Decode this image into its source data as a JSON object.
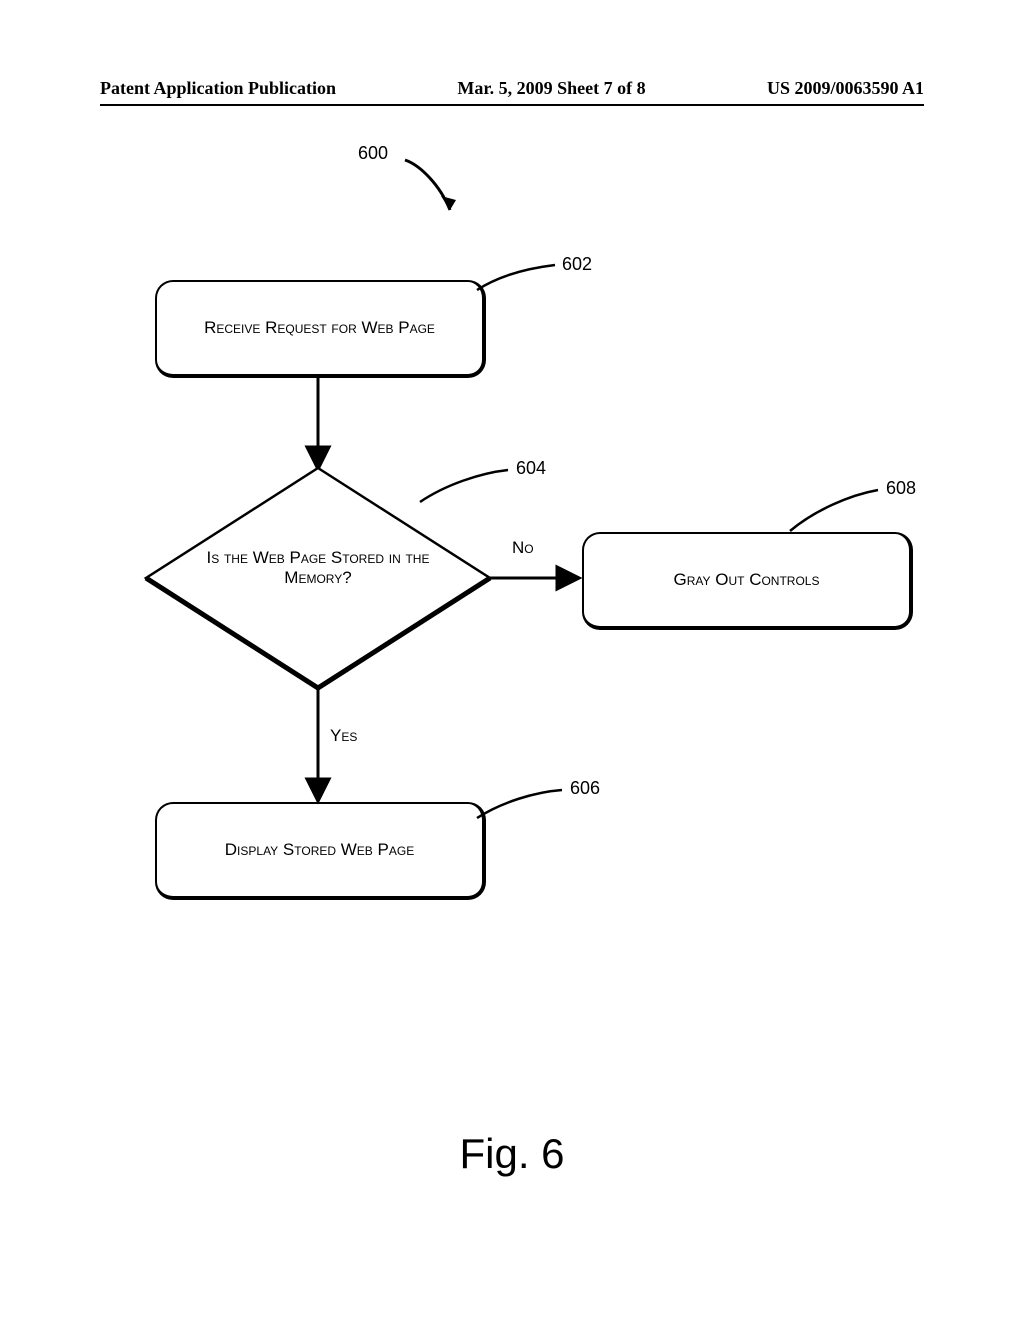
{
  "header": {
    "left": "Patent Application Publication",
    "center": "Mar. 5, 2009  Sheet 7 of 8",
    "right": "US 2009/0063590 A1"
  },
  "refs": {
    "r600": "600",
    "r602": "602",
    "r604": "604",
    "r606": "606",
    "r608": "608"
  },
  "nodes": {
    "step602": "Receive Request for Web Page",
    "decision604": "Is the Web Page Stored in the Memory?",
    "step606": "Display Stored Web Page",
    "step608": "Gray Out Controls"
  },
  "edges": {
    "no": "No",
    "yes": "Yes"
  },
  "figure_caption": "Fig. 6",
  "chart_data": {
    "type": "flowchart",
    "title": "Fig. 6",
    "reference_numeral": "600",
    "nodes": [
      {
        "id": "602",
        "kind": "process",
        "text": "Receive Request for Web Page"
      },
      {
        "id": "604",
        "kind": "decision",
        "text": "Is the Web Page Stored in the Memory?"
      },
      {
        "id": "606",
        "kind": "process",
        "text": "Display Stored Web Page"
      },
      {
        "id": "608",
        "kind": "process",
        "text": "Gray Out Controls"
      }
    ],
    "edges": [
      {
        "from": "602",
        "to": "604",
        "label": ""
      },
      {
        "from": "604",
        "to": "606",
        "label": "Yes"
      },
      {
        "from": "604",
        "to": "608",
        "label": "No"
      }
    ]
  }
}
